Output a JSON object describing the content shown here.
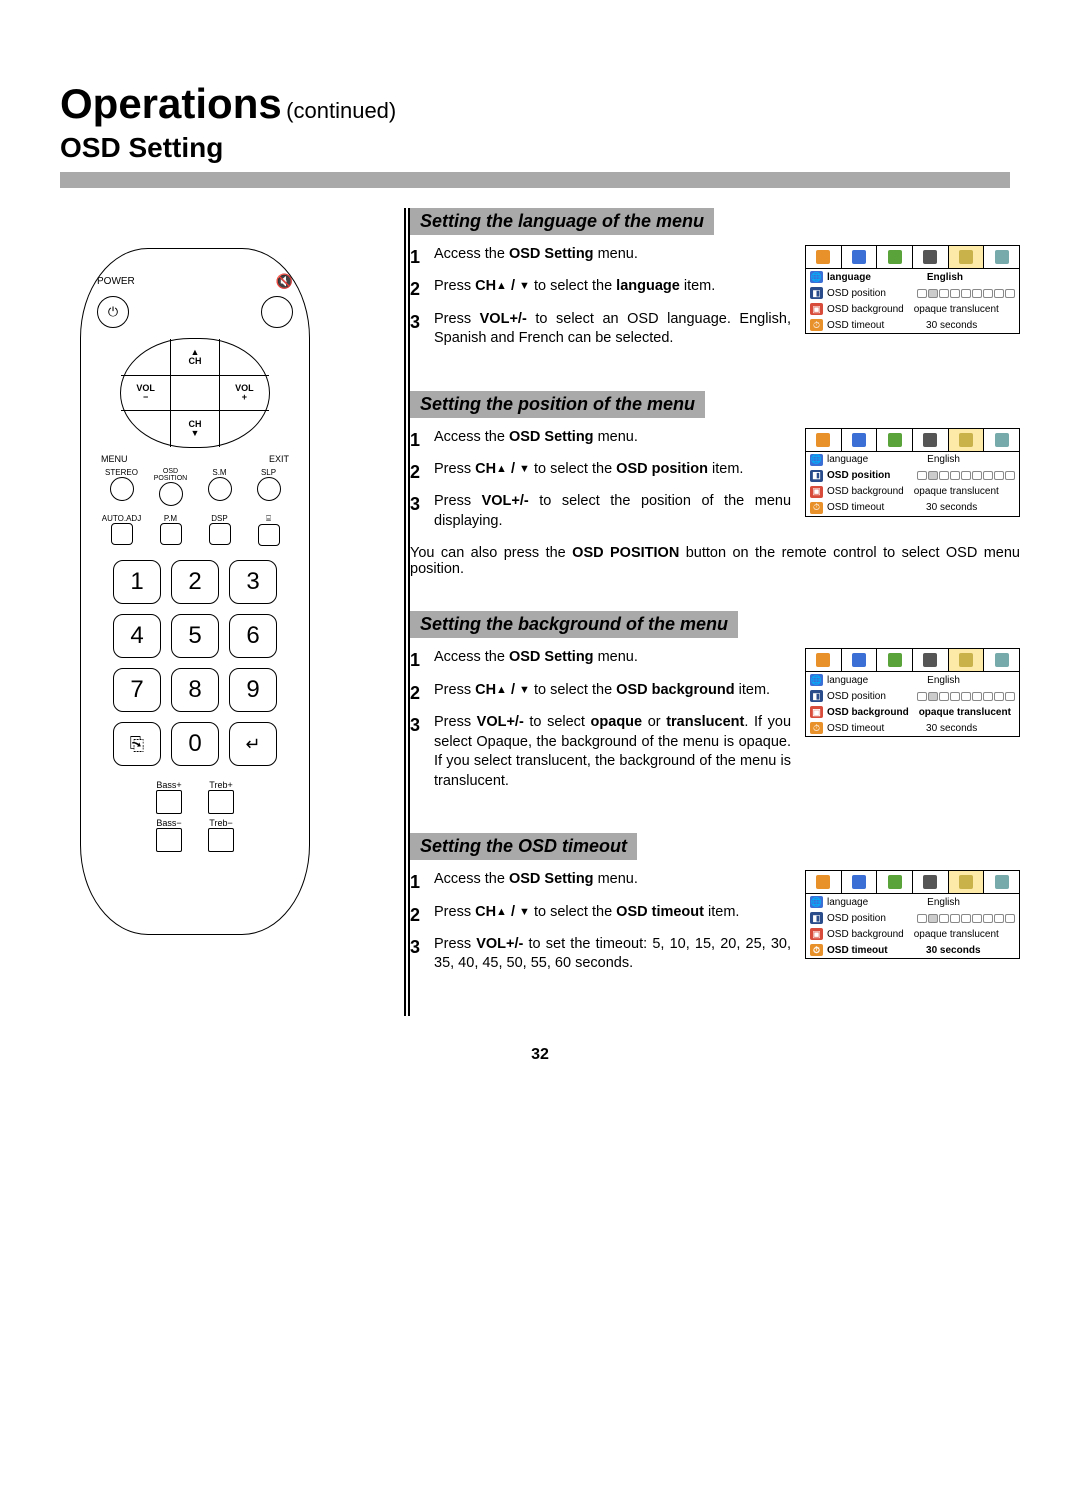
{
  "header": {
    "title_big": "Operations",
    "title_small": "(continued)",
    "subtitle": "OSD Setting"
  },
  "remote": {
    "power_label": "POWER",
    "power_symbol": "⏻",
    "mute_symbol": "🔇",
    "ch_up": "▲",
    "ch_label_top": "CH",
    "vol_minus": "VOL\n−",
    "vol_plus": "VOL\n+",
    "ch_label_bottom": "CH",
    "ch_down": "▼",
    "menu": "MENU",
    "exit": "EXIT",
    "row4": [
      "STEREO",
      "OSD\nPOSITION",
      "S.M",
      "SLP"
    ],
    "row5": [
      "AUTO.ADJ",
      "P.M",
      "DSP",
      "⌸"
    ],
    "nums": [
      "1",
      "2",
      "3",
      "4",
      "5",
      "6",
      "7",
      "8",
      "9",
      "⎘",
      "0",
      "↵"
    ],
    "bass_row1": [
      "Bass+",
      "Treb+"
    ],
    "bass_row2": [
      "Bass−",
      "Treb−"
    ]
  },
  "sections": [
    {
      "heading": "Setting the language of the menu",
      "steps": [
        {
          "n": "1",
          "parts": [
            "Access the ",
            {
              "b": "OSD Setting"
            },
            " menu."
          ]
        },
        {
          "n": "2",
          "parts": [
            "Press ",
            {
              "b": "CH"
            },
            {
              "arrow": "▲"
            },
            {
              "b": " / "
            },
            {
              "arrow": "▼"
            },
            " to select the ",
            {
              "b": "language"
            },
            " item."
          ]
        },
        {
          "n": "3",
          "parts": [
            "Press ",
            {
              "b": "VOL+/-"
            },
            " to select an OSD language. English, Spanish and French can be selected."
          ]
        }
      ],
      "note": "",
      "osd_hl": 0,
      "has_box": true
    },
    {
      "heading": "Setting the position of the menu",
      "steps": [
        {
          "n": "1",
          "parts": [
            "Access the ",
            {
              "b": "OSD Setting"
            },
            " menu."
          ]
        },
        {
          "n": "2",
          "parts": [
            "Press ",
            {
              "b": "CH"
            },
            {
              "arrow": "▲"
            },
            {
              "b": " / "
            },
            {
              "arrow": "▼"
            },
            " to select the ",
            {
              "b": "OSD position"
            },
            " item."
          ]
        },
        {
          "n": "3",
          "parts": [
            "Press ",
            {
              "b": "VOL+/-"
            },
            " to select the position of the menu displaying."
          ]
        }
      ],
      "note_parts": [
        "You can also press the ",
        {
          "b": "OSD POSITION"
        },
        " button on the remote control to select OSD menu position."
      ],
      "osd_hl": 1,
      "has_box": true
    },
    {
      "heading": "Setting the background of the menu",
      "steps": [
        {
          "n": "1",
          "parts": [
            "Access the ",
            {
              "b": "OSD Setting"
            },
            " menu."
          ]
        },
        {
          "n": "2",
          "parts": [
            "Press ",
            {
              "b": "CH"
            },
            {
              "arrow": "▲"
            },
            {
              "b": " / "
            },
            {
              "arrow": "▼"
            },
            " to select the ",
            {
              "b": "OSD background"
            },
            " item."
          ]
        },
        {
          "n": "3",
          "parts": [
            "Press ",
            {
              "b": "VOL+/-"
            },
            " to select ",
            {
              "b": "opaque"
            },
            " or ",
            {
              "b": "translucent"
            },
            ". If you select Opaque, the background of the menu is opaque. If you select translucent, the background of the menu is translucent."
          ]
        }
      ],
      "note": "",
      "osd_hl": 2,
      "has_box": true
    },
    {
      "heading": "Setting the OSD timeout",
      "steps": [
        {
          "n": "1",
          "parts": [
            "Access the ",
            {
              "b": "OSD Setting"
            },
            " menu."
          ]
        },
        {
          "n": "2",
          "parts": [
            "Press ",
            {
              "b": "CH"
            },
            {
              "arrow": "▲"
            },
            {
              "b": " / "
            },
            {
              "arrow": "▼"
            },
            " to select the ",
            {
              "b": "OSD timeout"
            },
            " item."
          ]
        },
        {
          "n": "3",
          "parts": [
            "Press ",
            {
              "b": "VOL+/-"
            },
            " to set the timeout: 5, 10, 15, 20, 25, 30, 35, 40, 45, 50, 55, 60 seconds."
          ]
        }
      ],
      "note": "",
      "osd_hl": 3,
      "has_box": true
    }
  ],
  "osd_rows": [
    {
      "icon_cls": "bg-blue",
      "icon": "🌐",
      "label": "language",
      "value": "English",
      "type": "text"
    },
    {
      "icon_cls": "bg-navy",
      "icon": "◧",
      "label": "OSD position",
      "value": "",
      "type": "boxes"
    },
    {
      "icon_cls": "bg-red",
      "icon": "▣",
      "label": "OSD background",
      "value": "opaque   translucent",
      "type": "text2",
      "v1": "opaque",
      "v2": "translucent"
    },
    {
      "icon_cls": "bg-orange",
      "icon": "⏱",
      "label": "OSD timeout",
      "value": "30 seconds",
      "type": "text"
    }
  ],
  "page_number": "32"
}
